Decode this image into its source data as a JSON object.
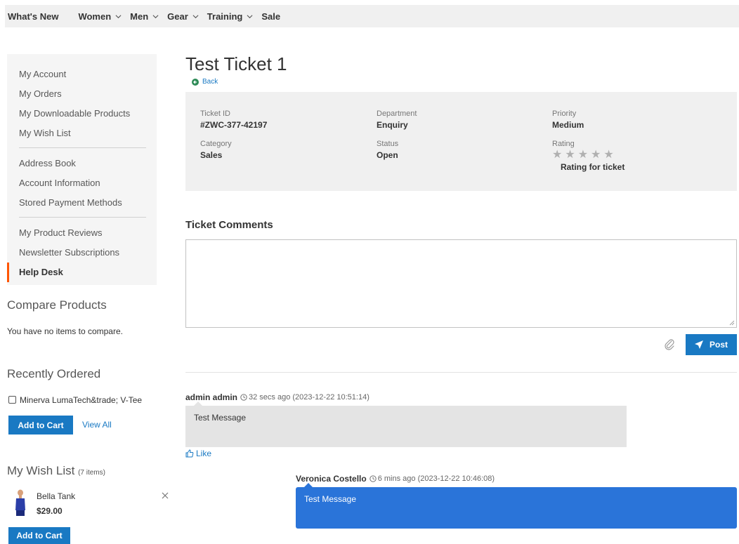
{
  "nav": {
    "items": [
      {
        "label": "What's New",
        "dropdown": false
      },
      {
        "label": "Women",
        "dropdown": true
      },
      {
        "label": "Men",
        "dropdown": true
      },
      {
        "label": "Gear",
        "dropdown": true
      },
      {
        "label": "Training",
        "dropdown": true
      },
      {
        "label": "Sale",
        "dropdown": false
      }
    ]
  },
  "sidebar": {
    "group1": [
      "My Account",
      "My Orders",
      "My Downloadable Products",
      "My Wish List"
    ],
    "group2": [
      "Address Book",
      "Account Information",
      "Stored Payment Methods"
    ],
    "group3": [
      "My Product Reviews",
      "Newsletter Subscriptions"
    ],
    "active": "Help Desk",
    "accent_color": "#ff5501"
  },
  "compare": {
    "title": "Compare Products",
    "empty_text": "You have no items to compare."
  },
  "recently_ordered": {
    "title": "Recently Ordered",
    "item": "Minerva LumaTech&trade; V-Tee",
    "add_to_cart": "Add to Cart",
    "view_all": "View All"
  },
  "wishlist": {
    "title": "My Wish List",
    "count": "(7 items)",
    "item_name": "Bella Tank",
    "item_price": "$29.00",
    "add_to_cart": "Add to Cart"
  },
  "ticket": {
    "title": "Test Ticket 1",
    "back": "Back",
    "fields": {
      "ticket_id_label": "Ticket ID",
      "ticket_id": "#ZWC-377-42197",
      "department_label": "Department",
      "department": "Enquiry",
      "priority_label": "Priority",
      "priority": "Medium",
      "category_label": "Category",
      "category": "Sales",
      "status_label": "Status",
      "status": "Open",
      "rating_label": "Rating",
      "rating_caption": "Rating for ticket",
      "rating_value": 0,
      "rating_max": 5
    }
  },
  "comments": {
    "title": "Ticket Comments",
    "post_label": "Post",
    "accent_color": "#1979c3"
  },
  "messages": [
    {
      "author": "admin admin",
      "time": "32 secs ago (2023-12-22 10:51:14)",
      "text": "Test Message",
      "like": "Like"
    },
    {
      "author": "Veronica Costello",
      "time": "6 mins ago (2023-12-22 10:46:08)",
      "text": "Test Message",
      "bubble_color": "#2a74d9"
    }
  ]
}
